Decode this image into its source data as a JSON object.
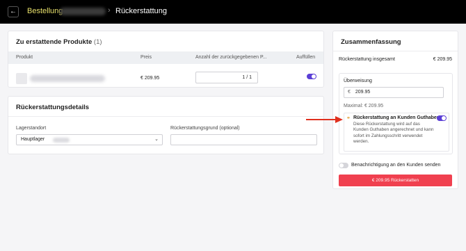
{
  "header": {
    "back_icon": "arrow-left-icon",
    "breadcrumb_link": "Bestellung",
    "separator": "›",
    "current": "Rückerstattung"
  },
  "products": {
    "title": "Zu erstattende Produkte",
    "count": "(1)",
    "columns": [
      "Produkt",
      "Preis",
      "Anzahl der zurückgegebenen P...",
      "Auffüllen"
    ],
    "rows": [
      {
        "price": "€ 209.95",
        "quantity": "1 / 1",
        "restock": true
      }
    ]
  },
  "details": {
    "title": "Rückerstattungsdetails",
    "location_label": "Lagerstandort",
    "location_value": "Hauptlager",
    "reason_label": "Rückerstattungsgrund (optional)",
    "reason_value": ""
  },
  "summary": {
    "title": "Zusammenfassung",
    "total_label": "Rückerstattung insgesamt",
    "total_value": "€ 209.95",
    "transfer_label": "Überweisung",
    "currency_symbol": "€",
    "amount_value": "209.95",
    "max_text": "Maximal: € 209.95",
    "credit_title": "Rückerstattung an Kunden Guthaben",
    "credit_enabled": true,
    "credit_desc": "Diese Rückerstattung wird auf das Kunden Guthaben angerechnet und kann sofort im Zahlungsschritt verwendet werden.",
    "notify_label": "Benachrichtigung an den Kunden senden",
    "notify_enabled": false,
    "refund_button": "€ 209.95 Rückerstatten"
  },
  "colors": {
    "accent": "#5b3fd6",
    "danger": "#f0404f",
    "breadcrumb": "#e8e06b",
    "arrow": "#e0301e"
  }
}
